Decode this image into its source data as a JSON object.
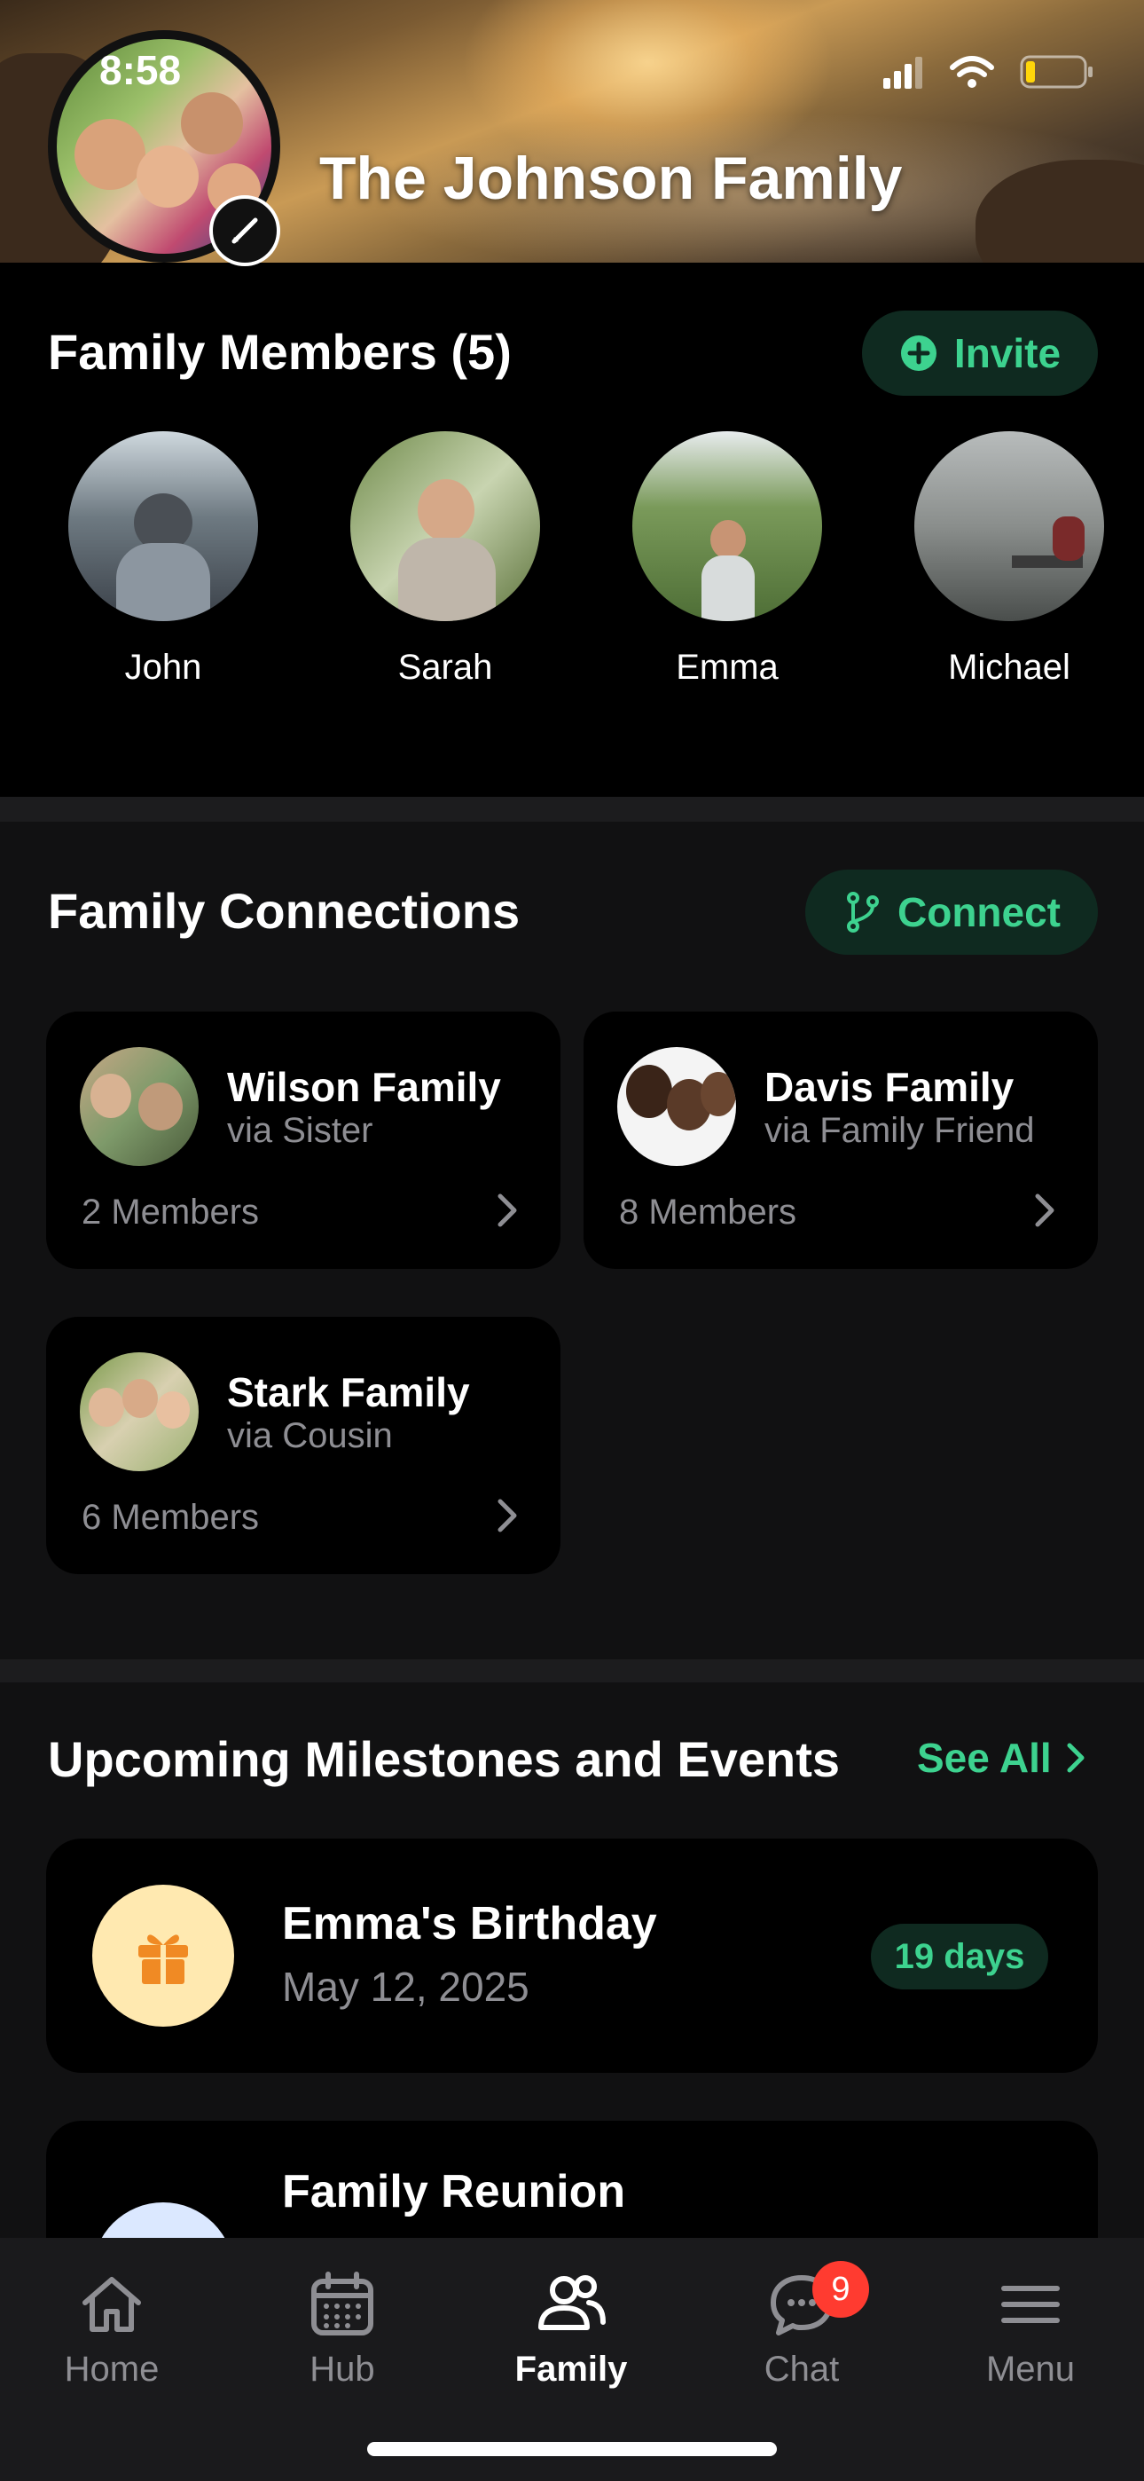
{
  "status_bar": {
    "time": "8:58"
  },
  "header": {
    "family_name": "The Johnson Family"
  },
  "members": {
    "title": "Family Members (5)",
    "invite_label": "Invite",
    "list": [
      {
        "name": "John"
      },
      {
        "name": "Sarah"
      },
      {
        "name": "Emma"
      },
      {
        "name": "Michael"
      }
    ]
  },
  "connections": {
    "title": "Family Connections",
    "connect_label": "Connect",
    "cards": [
      {
        "name": "Wilson Family",
        "via": "via Sister",
        "members": "2 Members"
      },
      {
        "name": "Davis Family",
        "via": "via Family Friend",
        "members": "8 Members"
      },
      {
        "name": "Stark Family",
        "via": "via Cousin",
        "members": "6 Members"
      }
    ]
  },
  "events": {
    "title": "Upcoming Milestones and Events",
    "see_all": "See All",
    "items": [
      {
        "title": "Emma's Birthday",
        "date": "May 12, 2025",
        "badge": "19 days"
      },
      {
        "title": "Family Reunion"
      }
    ]
  },
  "tabbar": {
    "tabs": [
      {
        "label": "Home"
      },
      {
        "label": "Hub"
      },
      {
        "label": "Family"
      },
      {
        "label": "Chat",
        "badge": "9"
      },
      {
        "label": "Menu"
      }
    ]
  },
  "colors": {
    "accent": "#3dd28f",
    "accent_bg": "#0f2a20",
    "badge_red": "#ff3b30"
  }
}
